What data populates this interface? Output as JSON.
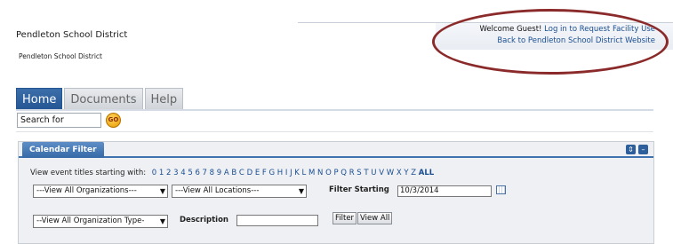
{
  "header": {
    "site_title": "Pendleton School District",
    "site_subtitle": "Pendleton School District",
    "welcome_text": "Welcome Guest!",
    "login_link": "Log in to Request Facility Use",
    "back_link": "Back to Pendleton School District Website"
  },
  "tabs": [
    {
      "label": "Home",
      "active": true
    },
    {
      "label": "Documents",
      "active": false
    },
    {
      "label": "Help",
      "active": false
    }
  ],
  "search": {
    "value": "Search for",
    "go_label": "GO"
  },
  "calendar_filter": {
    "title": "Calendar Filter",
    "view_titles_label": "View event titles starting with:",
    "letters": "0 1 2 3 4 5 6 7 8 9 A B C D E F G H I J K L M N O P Q R S T U V W X Y Z",
    "all_label": "ALL",
    "organizations_select": "---View All Organizations---",
    "locations_select": "---View All Locations---",
    "filter_starting_label": "Filter Starting",
    "filter_starting_value": "10/3/2014",
    "org_type_select": "--View All Organization Type-",
    "description_label": "Description",
    "description_value": "",
    "filter_button": "Filter",
    "view_all_button": "View All"
  },
  "colors": {
    "accent": "#245694",
    "link": "#1a4d8f",
    "annotation_oval": "#8b2a2a"
  }
}
